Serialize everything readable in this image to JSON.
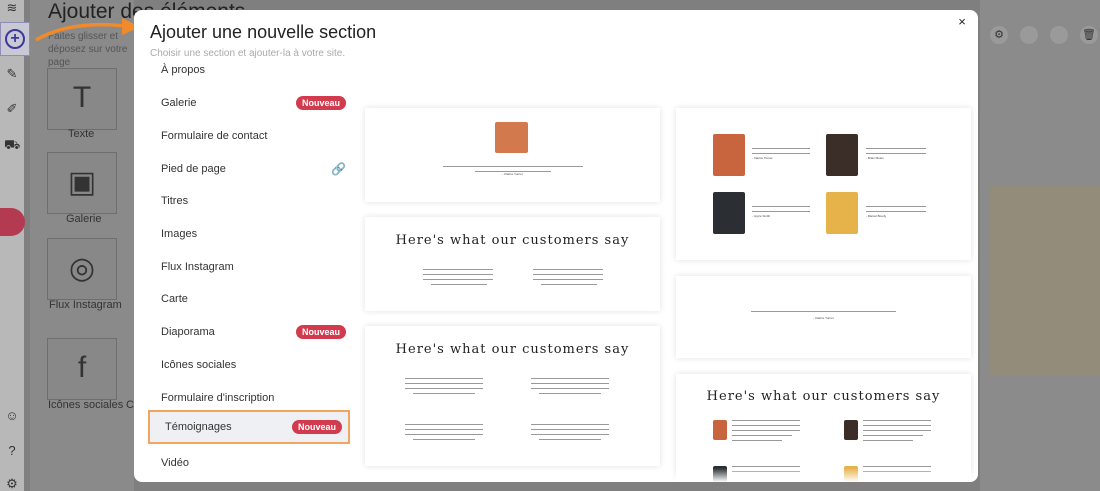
{
  "left_rail": {
    "icons": [
      "layers-icon",
      "paintbrush-icon",
      "pencil-icon",
      "cart-icon",
      "robot-icon",
      "smiley-icon",
      "help-icon",
      "settings-icon"
    ]
  },
  "elements_panel": {
    "title": "Ajouter des éléments",
    "subtitle": "Faites glisser et déposez sur votre page",
    "tiles": [
      {
        "label": "Texte",
        "glyph": "T"
      },
      {
        "label": "Galerie",
        "glyph": "▣"
      },
      {
        "label": "Flux Instagram",
        "glyph": "◎"
      },
      {
        "label": "Icônes sociales",
        "glyph": "f"
      }
    ],
    "partial_label": "Co"
  },
  "modal": {
    "title": "Ajouter une nouvelle section",
    "hint": "Choisir une section et ajouter-la à votre site.",
    "close_icon": "×",
    "sections": [
      {
        "label": "À propos"
      },
      {
        "label": "Galerie",
        "badge": "Nouveau"
      },
      {
        "label": "Formulaire de contact"
      },
      {
        "label": "Pied de page",
        "link_icon": "🔗"
      },
      {
        "label": "Titres"
      },
      {
        "label": "Images"
      },
      {
        "label": "Flux Instagram"
      },
      {
        "label": "Carte"
      },
      {
        "label": "Diaporama",
        "badge": "Nouveau"
      },
      {
        "label": "Icônes sociales"
      },
      {
        "label": "Formulaire d'inscription"
      },
      {
        "label": "Témoignages",
        "badge": "Nouveau",
        "selected": true
      },
      {
        "label": "Vidéo"
      }
    ],
    "preview_heading": "Here's what our customers say",
    "names": {
      "n1": "- Clarice Turner",
      "n2": "- Brian Moten",
      "n3": "- Joyce Smith",
      "n4": "- Marcel Boudy"
    }
  },
  "colors": {
    "badge": "#d23a4d",
    "highlight": "#f3a45e",
    "arrow": "#f08a2a"
  }
}
